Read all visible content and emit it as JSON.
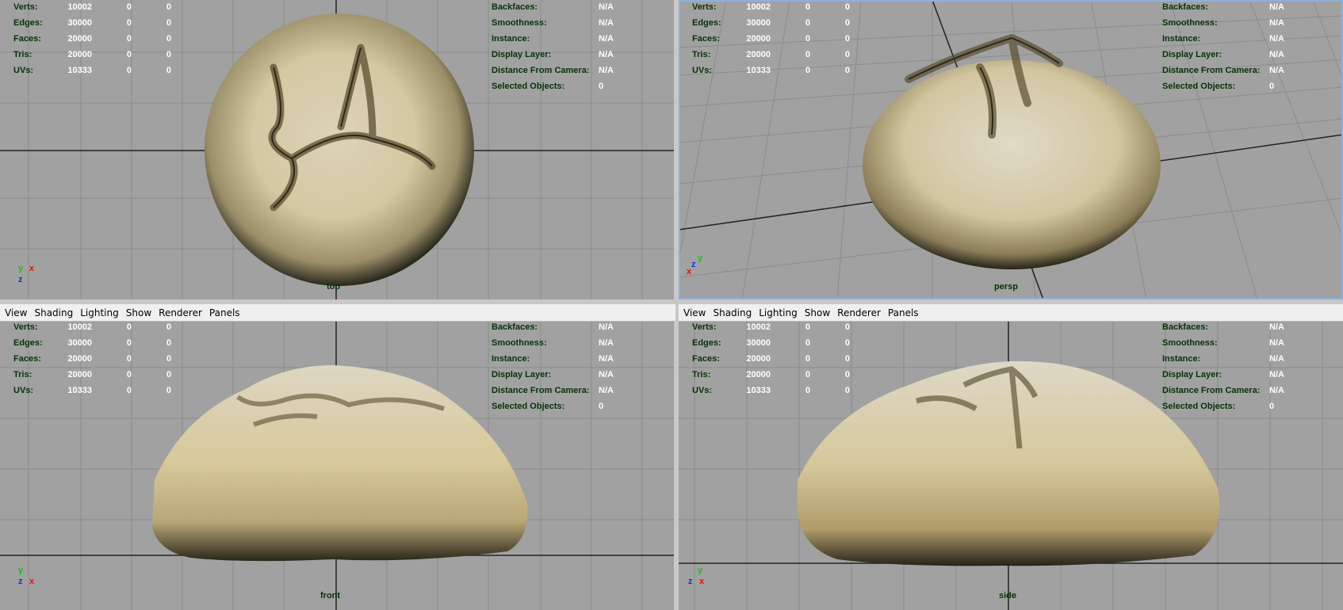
{
  "menu": [
    "View",
    "Shading",
    "Lighting",
    "Show",
    "Renderer",
    "Panels"
  ],
  "stats": [
    {
      "label": "Verts:",
      "v1": "10002",
      "v2": "0",
      "v3": "0"
    },
    {
      "label": "Edges:",
      "v1": "30000",
      "v2": "0",
      "v3": "0"
    },
    {
      "label": "Faces:",
      "v1": "20000",
      "v2": "0",
      "v3": "0"
    },
    {
      "label": "Tris:",
      "v1": "20000",
      "v2": "0",
      "v3": "0"
    },
    {
      "label": "UVs:",
      "v1": "10333",
      "v2": "0",
      "v3": "0"
    }
  ],
  "info": [
    {
      "label": "Backfaces:",
      "value": "N/A"
    },
    {
      "label": "Smoothness:",
      "value": "N/A"
    },
    {
      "label": "Instance:",
      "value": "N/A"
    },
    {
      "label": "Display Layer:",
      "value": "N/A"
    },
    {
      "label": "Distance From Camera:",
      "value": "N/A"
    },
    {
      "label": "Selected Objects:",
      "value": "0"
    }
  ],
  "axes": {
    "x": "x",
    "y": "y",
    "z": "z"
  },
  "panes": {
    "top": {
      "camera": "top"
    },
    "persp": {
      "camera": "persp"
    },
    "front": {
      "camera": "front"
    },
    "side": {
      "camera": "side"
    }
  },
  "colors": {
    "viewport_bg": "#a1a1a1",
    "grid": "#8a8a8a",
    "hud_label": "#063306",
    "hud_value": "#ffffff",
    "bread_light": "#e6dfc9",
    "bread_mid": "#c9b98a",
    "bread_dark": "#2c2a1c"
  }
}
